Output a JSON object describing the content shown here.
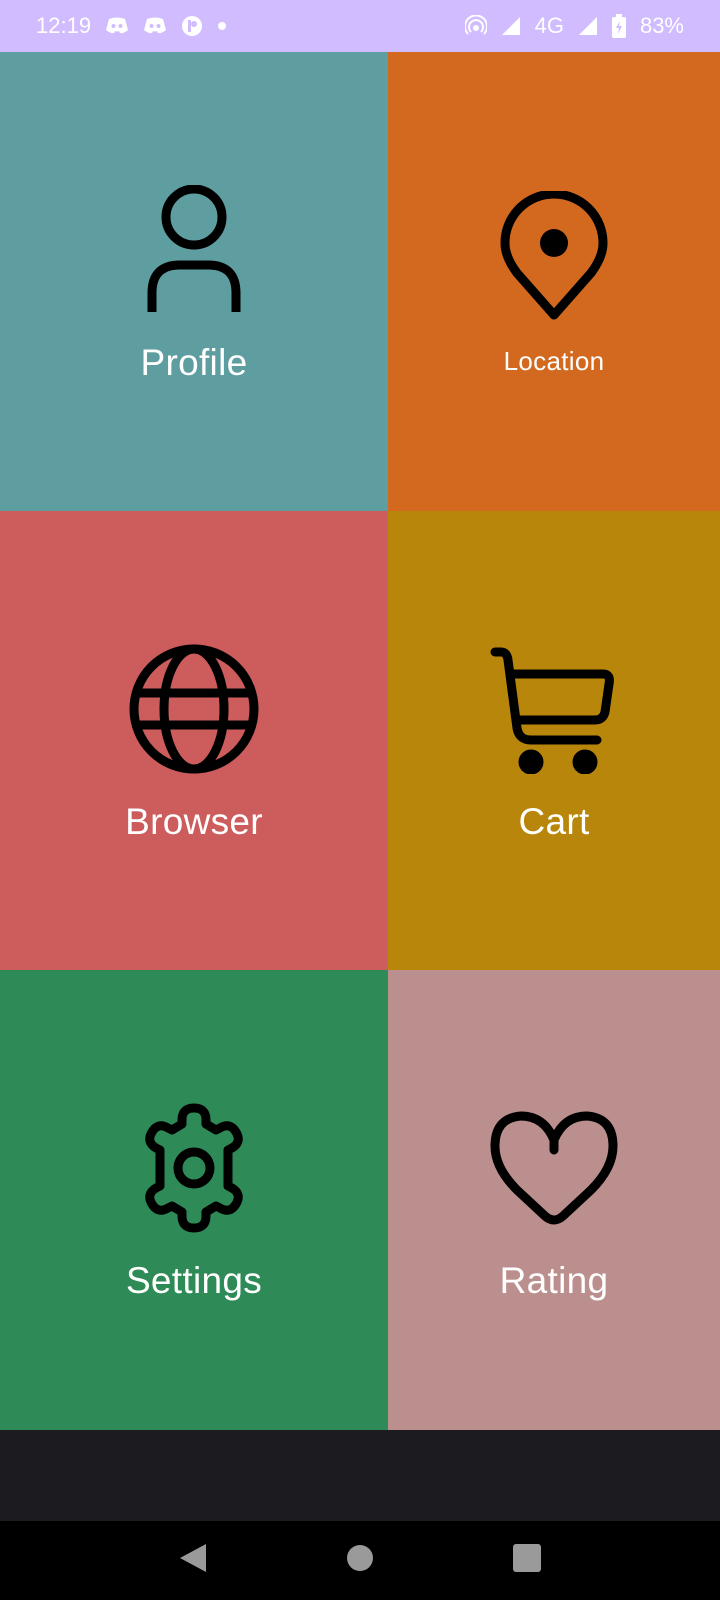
{
  "status_bar": {
    "time": "12:19",
    "network": "4G",
    "battery": "83%",
    "background": "#d0bcff"
  },
  "tiles": [
    {
      "label": "Profile",
      "icon": "person-icon",
      "color": "#5f9ea0"
    },
    {
      "label": "Location",
      "icon": "location-pin-icon",
      "color": "#d2691e"
    },
    {
      "label": "Browser",
      "icon": "globe-icon",
      "color": "#cd5c5c"
    },
    {
      "label": "Cart",
      "icon": "cart-icon",
      "color": "#b8860b"
    },
    {
      "label": "Settings",
      "icon": "gear-icon",
      "color": "#2e8b57"
    },
    {
      "label": "Rating",
      "icon": "heart-icon",
      "color": "#bc8f8f"
    }
  ],
  "nav_bar": {
    "back": "back-icon",
    "home": "home-icon",
    "recents": "recents-icon"
  }
}
